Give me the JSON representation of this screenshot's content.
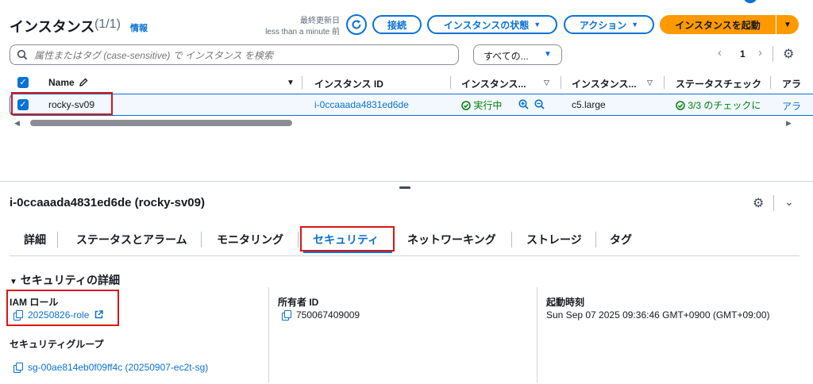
{
  "header": {
    "title": "インスタンス",
    "count": "(1/1)",
    "info": "情報",
    "last_updated_label": "最終更新日",
    "last_updated_value": "less than a minute 前",
    "connect": "接続",
    "instance_state": "インスタンスの状態",
    "actions": "アクション",
    "launch": "インスタンスを起動"
  },
  "search": {
    "placeholder": "属性またはタグ (case-sensitive) で インスタンス を検索",
    "filter_value": "すべての...",
    "page": "1"
  },
  "table": {
    "columns": [
      "Name",
      "インスタンス ID",
      "インスタンス...",
      "インスタンス...",
      "ステータスチェック",
      "アラ"
    ],
    "row": {
      "name": "rocky-sv09",
      "instance_id": "i-0ccaaada4831ed6de",
      "state": "実行中",
      "type": "c5.large",
      "status_check": "3/3 のチェックに",
      "alarm": "アラ"
    }
  },
  "detail": {
    "title": "i-0ccaaada4831ed6de (rocky-sv09)",
    "tabs": [
      "詳細",
      "ステータスとアラーム",
      "モニタリング",
      "セキュリティ",
      "ネットワーキング",
      "ストレージ",
      "タグ"
    ],
    "section_title": "セキュリティの詳細",
    "iam_role_label": "IAM ロール",
    "iam_role_value": "20250826-role",
    "owner_label": "所有者 ID",
    "owner_value": "750067409009",
    "launch_time_label": "起動時刻",
    "launch_time_value": "Sun Sep 07 2025 09:36:46 GMT+0900 (GMT+09:00)",
    "sg_label": "セキュリティグループ",
    "sg_value": "sg-00ae814eb0f09ff4c (20250907-ec2t-sg)"
  },
  "colors": {
    "accent": "#0972d3",
    "orange": "#ff9900",
    "running": "#037f0c",
    "highlight": "#d91515"
  }
}
